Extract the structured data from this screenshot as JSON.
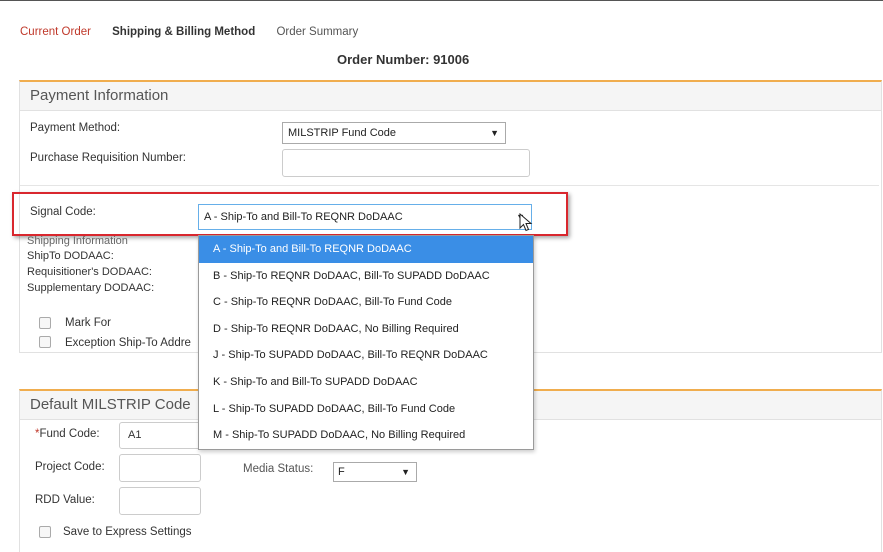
{
  "tabs": {
    "current_order": "Current Order",
    "shipping_billing": "Shipping & Billing Method",
    "order_summary": "Order Summary"
  },
  "order_number": "Order Number: 91006",
  "payment": {
    "title": "Payment Information",
    "method_label": "Payment Method:",
    "method_value": "MILSTRIP Fund Code",
    "prn_label": "Purchase Requisition Number:",
    "prn_value": ""
  },
  "signal": {
    "label": "Signal Code:",
    "value": "A - Ship-To and Bill-To REQNR DoDAAC",
    "options": [
      "A - Ship-To and Bill-To REQNR DoDAAC",
      "B - Ship-To REQNR DoDAAC, Bill-To SUPADD DoDAAC",
      "C - Ship-To REQNR DoDAAC, Bill-To Fund Code",
      "D - Ship-To REQNR DoDAAC, No Billing Required",
      "J - Ship-To SUPADD DoDAAC, Bill-To REQNR DoDAAC",
      "K - Ship-To and Bill-To SUPADD DoDAAC",
      "L - Ship-To SUPADD DoDAAC, Bill-To Fund Code",
      "M - Ship-To SUPADD DoDAAC, No Billing Required"
    ],
    "selected_index": 0
  },
  "shipping": {
    "heading": "Shipping Information",
    "shipto_label": "ShipTo DODAAC:",
    "requisitioner_label": "Requisitioner's DODAAC:",
    "supplementary_label": "Supplementary DODAAC:",
    "mark_for_label": "Mark For",
    "exception_label": "Exception Ship-To Addre"
  },
  "milstrip": {
    "title": "Default MILSTRIP Code",
    "fund_required": "*",
    "fund_label": "Fund Code:",
    "fund_value": "A1",
    "project_label": "Project Code:",
    "project_value": "",
    "media_label": "Media Status:",
    "media_value": "F",
    "rdd_label": "RDD Value:",
    "rdd_value": "",
    "save_label": "Save to Express Settings"
  },
  "colors": {
    "accent": "#f0ad4e",
    "highlight": "#d9272e",
    "selected": "#3a8ee6",
    "current_tab": "#c0392b"
  }
}
